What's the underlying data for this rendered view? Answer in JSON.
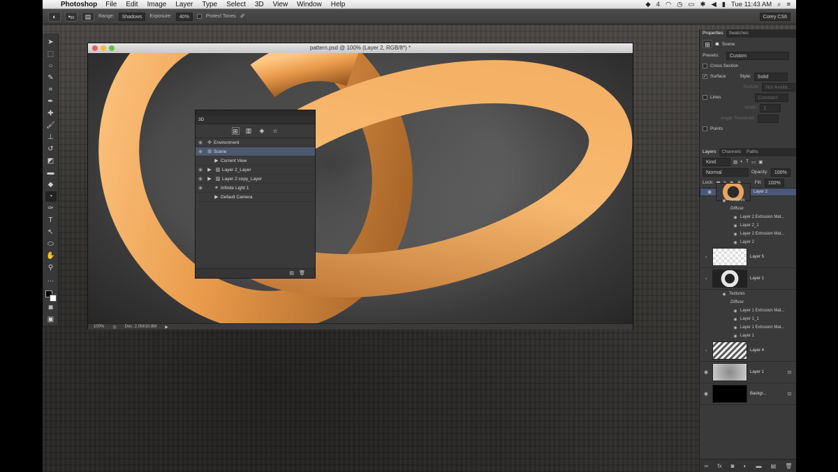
{
  "menubar": {
    "app": "Photoshop",
    "items": [
      "File",
      "Edit",
      "Image",
      "Layer",
      "Type",
      "Select",
      "3D",
      "View",
      "Window",
      "Help"
    ],
    "status_count": "4",
    "clock": "Tue 11:43 AM"
  },
  "options": {
    "range_label": "Range:",
    "range_value": "Shadows",
    "exposure_label": "Exposure:",
    "exposure_value": "40%",
    "protect_label": "Protect Tones",
    "brush_size": "80",
    "workspace": "Corey CS6"
  },
  "document": {
    "title": "pattern.psd @ 100% (Layer 2, RGB/8*) *",
    "zoom": "100%",
    "doc_size": "Doc: 2.0M/10.8M"
  },
  "panel3d": {
    "tab": "3D",
    "rows": [
      {
        "label": "Environment"
      },
      {
        "label": "Scene"
      },
      {
        "label": "Current View"
      },
      {
        "label": "Layer 2_Layer"
      },
      {
        "label": "Layer 2 copy_Layer"
      },
      {
        "label": "Infinite Light 1"
      },
      {
        "label": "Default Camera"
      }
    ]
  },
  "properties": {
    "tabs": [
      "Properties",
      "Swatches"
    ],
    "scene_label": "Scene",
    "presets_label": "Presets:",
    "presets_value": "Custom",
    "cross_section": "Cross Section",
    "surface": "Surface",
    "style_label": "Style:",
    "style_value": "Solid",
    "texture_label": "Texture:",
    "texture_value": "Not Availa...",
    "lines": "Lines",
    "lines_style_value": "Constant",
    "width_label": "Width:",
    "width_value": "1",
    "angle_label": "Angle Threshold:",
    "points": "Points"
  },
  "layers": {
    "tabs": [
      "Layers",
      "Channels",
      "Paths"
    ],
    "kind_label": "Kind",
    "blend": "Normal",
    "opacity_label": "Opacity:",
    "opacity_value": "100%",
    "lock_label": "Lock:",
    "fill_label": "Fill:",
    "fill_value": "100%",
    "list": [
      {
        "name": "Layer 2"
      },
      {
        "name": "Layer 5"
      },
      {
        "name": "Layer 1"
      },
      {
        "name": "Layer 4"
      },
      {
        "name": "Layer 1"
      },
      {
        "name": "Backgr..."
      }
    ],
    "layer2_subs": [
      "Textures",
      "Diffuse",
      "Layer 2 Extrusion Mat...",
      "Layer 2_1",
      "Layer 2 Extrusion Mat...",
      "Layer 2"
    ],
    "layer1_subs": [
      "Textures",
      "Diffuse",
      "Layer 1 Extrusion Mat...",
      "Layer 1_1",
      "Layer 1 Extrusion Mat...",
      "Layer 1"
    ]
  }
}
